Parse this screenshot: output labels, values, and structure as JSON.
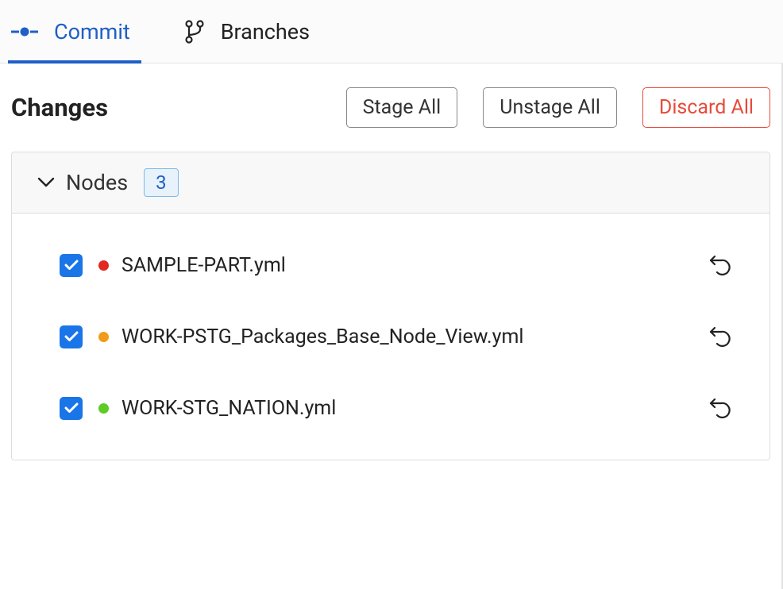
{
  "tabs": [
    {
      "label": "Commit",
      "active": true,
      "icon": "commit-icon"
    },
    {
      "label": "Branches",
      "active": false,
      "icon": "branch-icon"
    }
  ],
  "header": {
    "title": "Changes"
  },
  "actions": {
    "stage_all": "Stage All",
    "unstage_all": "Unstage All",
    "discard_all": "Discard All"
  },
  "section": {
    "label": "Nodes",
    "count": "3"
  },
  "status_colors": {
    "red": "#e2281f",
    "orange": "#f29b18",
    "green": "#5ecb26"
  },
  "files": [
    {
      "name": "SAMPLE-PART.yml",
      "status": "red",
      "checked": true
    },
    {
      "name": "WORK-PSTG_Packages_Base_Node_View.yml",
      "status": "orange",
      "checked": true
    },
    {
      "name": "WORK-STG_NATION.yml",
      "status": "green",
      "checked": true
    }
  ]
}
